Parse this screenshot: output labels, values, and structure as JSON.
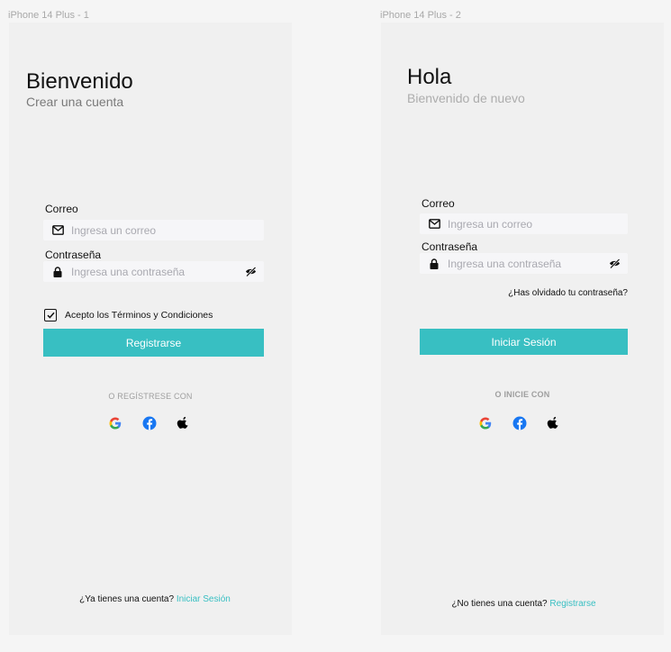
{
  "frames": {
    "frame1": {
      "label": "iPhone 14 Plus - 1"
    },
    "frame2": {
      "label": "iPhone 14 Plus - 2"
    }
  },
  "register": {
    "title": "Bienvenido",
    "subtitle": "Crear una cuenta",
    "email_label": "Correo",
    "email_placeholder": "Ingresa un correo",
    "password_label": "Contraseña",
    "password_placeholder": "Ingresa una contraseña",
    "terms_label": "Acepto los Términos y Condiciones",
    "terms_checked": true,
    "submit_label": "Registrarse",
    "social_label": "O REGÍSTRESE CON",
    "footer_text": "¿Ya tienes una cuenta?",
    "footer_link": "Iniciar Sesión"
  },
  "login": {
    "title": "Hola",
    "subtitle": "Bienvenido de nuevo",
    "email_label": "Correo",
    "email_placeholder": "Ingresa un correo",
    "password_label": "Contraseña",
    "password_placeholder": "Ingresa una contraseña",
    "forgot_label": "¿Has olvidado tu contraseña?",
    "submit_label": "Iniciar Sesión",
    "social_label": "O INICIE CON",
    "footer_text": "¿No tienes una cuenta?",
    "footer_link": "Registrarse"
  },
  "icons": {
    "email": "envelope-icon",
    "password": "lock-icon",
    "toggle_visibility": "eye-off-icon",
    "social": [
      "google-icon",
      "facebook-icon",
      "apple-icon"
    ]
  },
  "colors": {
    "accent": "#38bfc2",
    "frame_bg": "#f0f0f0",
    "input_bg": "#f6f6f8"
  }
}
